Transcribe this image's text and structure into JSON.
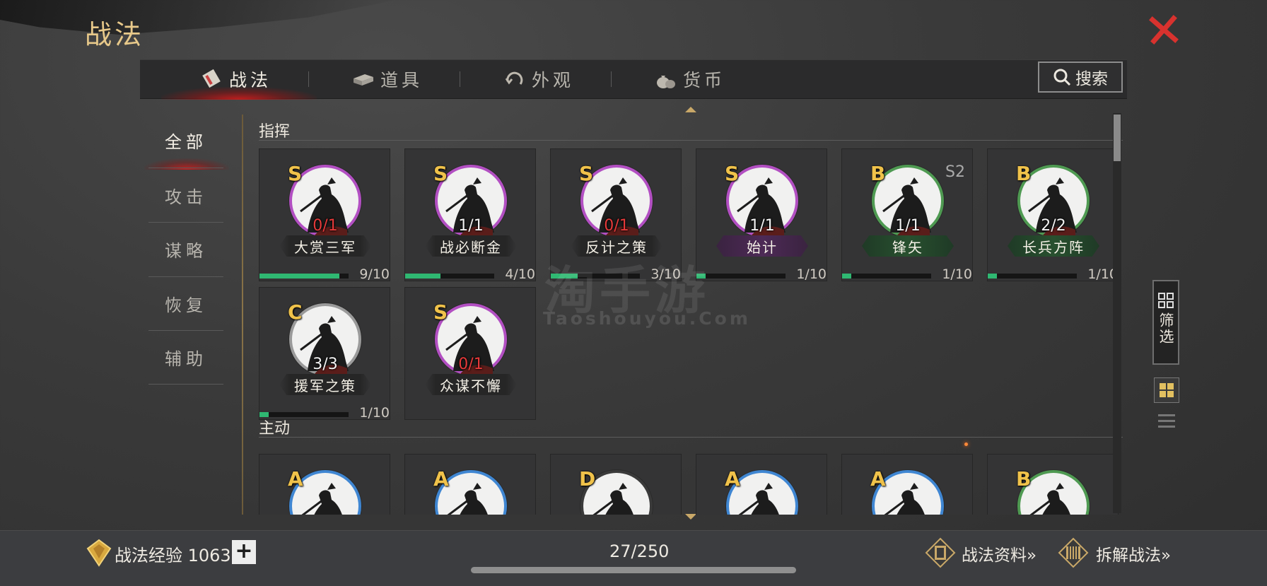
{
  "page": {
    "title": "战法",
    "close_icon": "close-icon"
  },
  "tabs": [
    {
      "label": "战法",
      "icon": "tactics-scroll-icon",
      "active": true
    },
    {
      "label": "道具",
      "icon": "item-box-icon",
      "active": false
    },
    {
      "label": "外观",
      "icon": "appearance-swirl-icon",
      "active": false
    },
    {
      "label": "货币",
      "icon": "money-bag-icon",
      "active": false
    }
  ],
  "search": {
    "label": "搜索",
    "icon": "search-icon"
  },
  "sidebar": {
    "items": [
      {
        "label": "全部",
        "active": true
      },
      {
        "label": "攻击",
        "active": false
      },
      {
        "label": "谋略",
        "active": false
      },
      {
        "label": "恢复",
        "active": false
      },
      {
        "label": "辅助",
        "active": false
      }
    ]
  },
  "sections": [
    {
      "title": "指挥",
      "cards": [
        {
          "grade": "S",
          "count": "0/1",
          "count_red": true,
          "name": "大赏三军",
          "progress": "9/10",
          "fill": 0.9,
          "ring": "purple",
          "season": ""
        },
        {
          "grade": "S",
          "count": "1/1",
          "count_red": false,
          "name": "战必断金",
          "progress": "4/10",
          "fill": 0.4,
          "ring": "purple",
          "season": ""
        },
        {
          "grade": "S",
          "count": "0/1",
          "count_red": true,
          "name": "反计之策",
          "progress": "3/10",
          "fill": 0.3,
          "ring": "purple",
          "season": ""
        },
        {
          "grade": "S",
          "count": "1/1",
          "count_red": false,
          "name": "始计",
          "progress": "1/10",
          "fill": 0.1,
          "ring": "purple",
          "season": ""
        },
        {
          "grade": "B",
          "count": "1/1",
          "count_red": false,
          "name": "锋矢",
          "progress": "1/10",
          "fill": 0.1,
          "ring": "green",
          "season": "S2"
        },
        {
          "grade": "B",
          "count": "2/2",
          "count_red": false,
          "name": "长兵方阵",
          "progress": "1/10",
          "fill": 0.1,
          "ring": "green",
          "season": ""
        },
        {
          "grade": "C",
          "count": "3/3",
          "count_red": false,
          "name": "援军之策",
          "progress": "1/10",
          "fill": 0.1,
          "ring": "gray",
          "season": ""
        },
        {
          "grade": "S",
          "count": "0/1",
          "count_red": true,
          "name": "众谋不懈",
          "progress": "",
          "fill": 0,
          "ring": "purple",
          "season": ""
        }
      ]
    },
    {
      "title": "主动",
      "cards": [
        {
          "grade": "A",
          "ring": "blue"
        },
        {
          "grade": "A",
          "ring": "blue"
        },
        {
          "grade": "D",
          "ring": "dark"
        },
        {
          "grade": "A",
          "ring": "blue"
        },
        {
          "grade": "A",
          "ring": "blue"
        },
        {
          "grade": "B",
          "ring": "green"
        }
      ]
    }
  ],
  "filter": {
    "label": "筛选",
    "icon": "filter-grid-icon"
  },
  "view_toggle": {
    "grid_icon": "grid-view-icon",
    "list_icon": "list-view-icon"
  },
  "bottom": {
    "exp_label": "战法经验 1063",
    "plus": "+",
    "capacity": "27/250",
    "link_info": "战法资料»",
    "link_dismantle": "拆解战法»"
  },
  "watermark": {
    "main": "淘手游",
    "sub": "Taoshouyou.Com"
  },
  "colors": {
    "accent_gold": "#e8c98a",
    "grade_gold": "#f0c24a",
    "red_close": "#d8322e",
    "progress_green": "#2fb872",
    "ring_purple": "#b24fc2",
    "ring_green": "#4f9a52",
    "ring_blue": "#3f86d2"
  }
}
